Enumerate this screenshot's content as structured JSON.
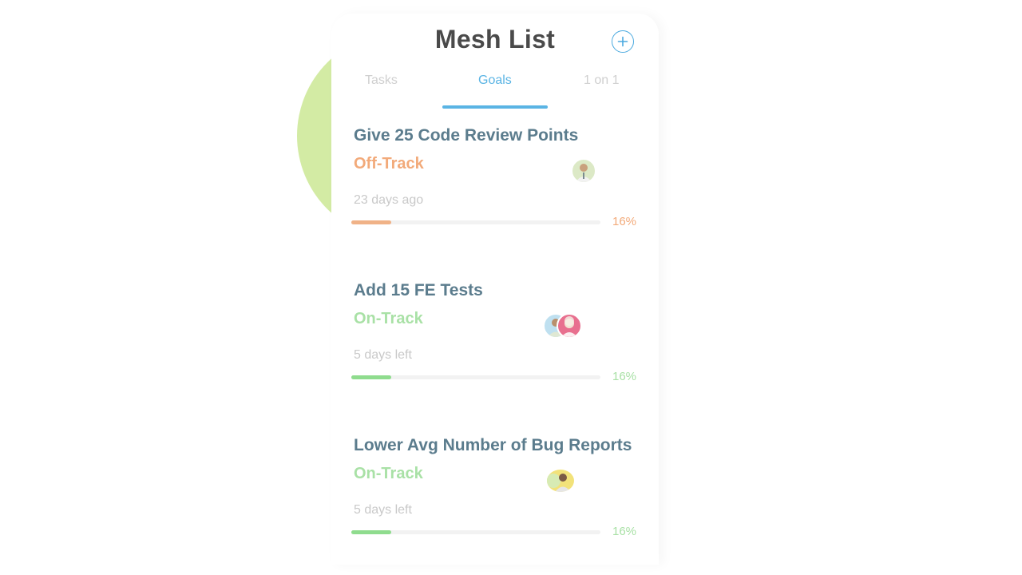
{
  "header": {
    "title": "Mesh List",
    "add_icon": "plus-circle-icon"
  },
  "tabs": [
    {
      "label": "Tasks",
      "active": false
    },
    {
      "label": "Goals",
      "active": true
    },
    {
      "label": "1 on 1",
      "active": false
    }
  ],
  "goals": [
    {
      "name": "Give 25 Code Review Points",
      "status": "Off-Track",
      "time": "23 days ago",
      "progress": 0.16,
      "progress_label": "16%",
      "status_color": "#f2aa7a",
      "bar_color": "#f0b287",
      "avatars": [
        "person-avatar"
      ]
    },
    {
      "name": "Add 15 FE Tests",
      "status": "On-Track",
      "time": "5 days left",
      "progress": 0.16,
      "progress_label": "16%",
      "status_color": "#a9e1a6",
      "bar_color": "#8fdc8e",
      "avatars": [
        "person-avatar",
        "person-avatar"
      ]
    },
    {
      "name": "Lower Avg Number of Bug Reports",
      "status": "On-Track",
      "time": "5 days left",
      "progress": 0.16,
      "progress_label": "16%",
      "status_color": "#a9e1a6",
      "bar_color": "#8fdc8e",
      "avatars": [
        "person-avatar"
      ]
    }
  ],
  "colors": {
    "accent": "#5ab4e4",
    "decor_circle": "#d3eba4",
    "title_text": "#4a4a4a",
    "goal_text": "#5b7c8d"
  }
}
